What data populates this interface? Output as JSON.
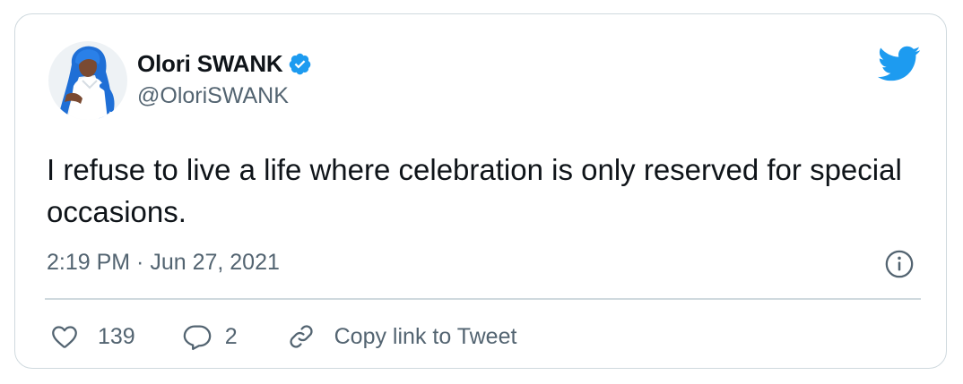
{
  "author": {
    "display_name": "Olori SWANK",
    "handle": "@OloriSWANK",
    "verified": true
  },
  "tweet": {
    "text": "I refuse to live a life where celebration is only reserved for special occasions.",
    "timestamp": "2:19 PM · Jun 27, 2021"
  },
  "actions": {
    "likes": "139",
    "replies": "2",
    "copy_link_label": "Copy link to Tweet"
  },
  "icons": {
    "brand": "twitter-bird-icon",
    "verified": "verified-badge-icon",
    "info": "info-icon",
    "like": "heart-icon",
    "reply": "reply-bubble-icon",
    "copy": "link-icon"
  },
  "colors": {
    "twitter_blue": "#1d9bf0",
    "text_primary": "#0f1419",
    "text_secondary": "#536471",
    "border": "#cfd9de"
  }
}
